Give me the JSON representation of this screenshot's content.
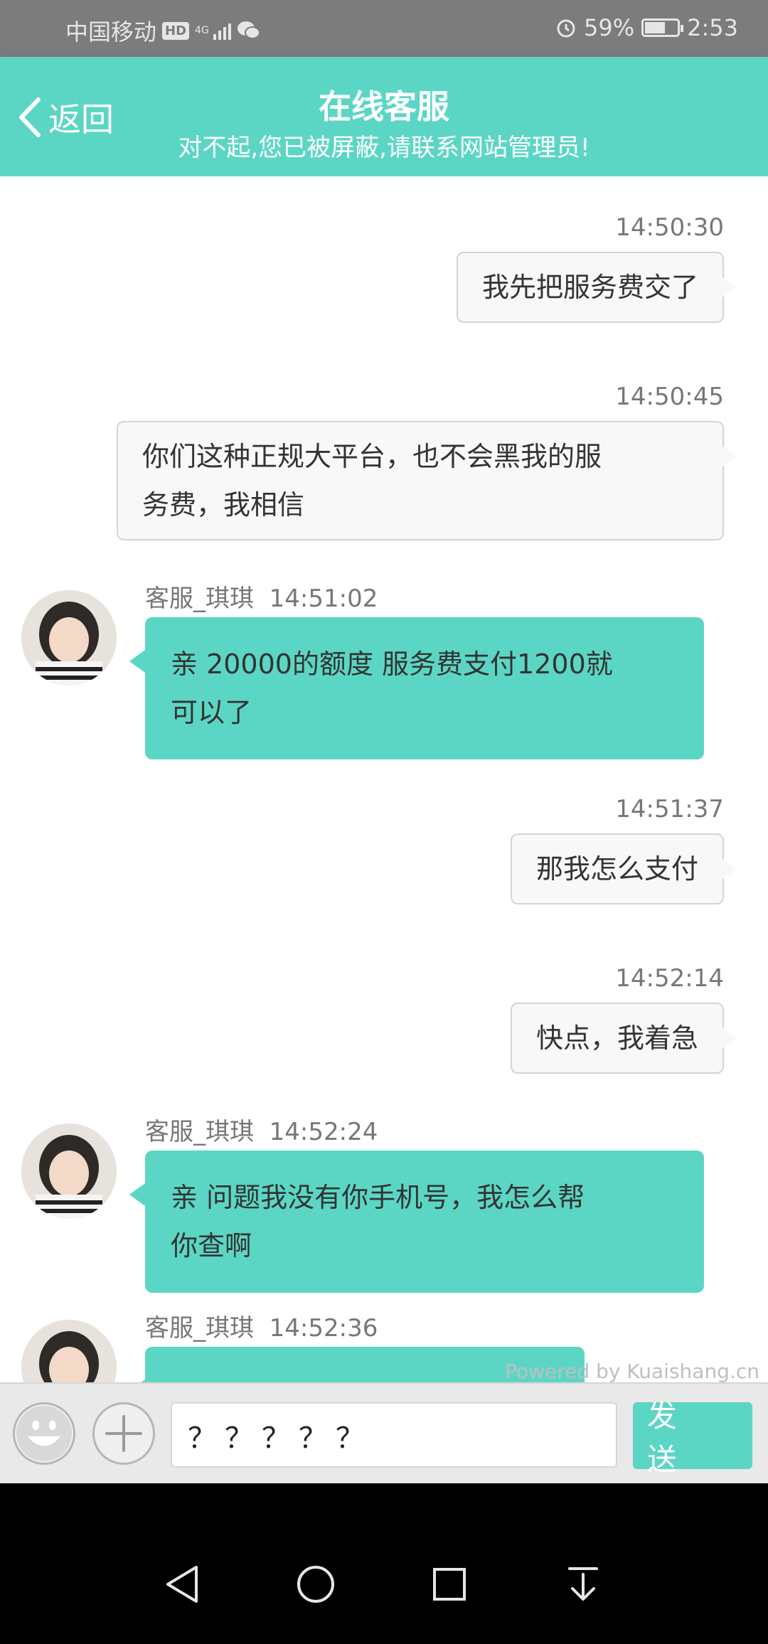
{
  "status_bar": {
    "carrier": "中国移动",
    "hd": "HD",
    "network": "4G",
    "battery": "59%",
    "time": "2:53"
  },
  "header": {
    "back_label": "返回",
    "title": "在线客服",
    "subtitle": "对不起,您已被屏蔽,请联系网站管理员!"
  },
  "messages": [
    {
      "side": "right",
      "time": "14:50:30",
      "text": "我先把服务费交了"
    },
    {
      "side": "right",
      "time": "14:50:45",
      "text_lines": [
        "你们这种正规大平台，也不会黑我的服",
        "务费，我相信"
      ]
    },
    {
      "side": "left",
      "sender": "客服_琪琪",
      "time": "14:51:02",
      "text_lines": [
        "亲 20000的额度 服务费支付1200就",
        "可以了"
      ]
    },
    {
      "side": "right",
      "time": "14:51:37",
      "text": "那我怎么支付"
    },
    {
      "side": "right",
      "time": "14:52:14",
      "text": "快点，我着急"
    },
    {
      "side": "left",
      "sender": "客服_琪琪",
      "time": "14:52:24",
      "text_lines": [
        "亲 问题我没有你手机号，我怎么帮",
        "你查啊"
      ]
    },
    {
      "side": "left",
      "sender": "客服_琪琪",
      "time": "14:52:36",
      "text": ""
    }
  ],
  "powered_by": "Powered by Kuaishang.cn",
  "input_bar": {
    "input_value": "？？？？？",
    "send_label": "发 送"
  },
  "colors": {
    "accent": "#5cd6c4",
    "status_bar": "#7c7c7c",
    "right_bubble": "#f8f8f8"
  },
  "icons": [
    "smiley-icon",
    "plus-icon",
    "back-chevron-icon",
    "nav-back-icon",
    "nav-home-icon",
    "nav-recents-icon",
    "nav-notifications-icon"
  ]
}
